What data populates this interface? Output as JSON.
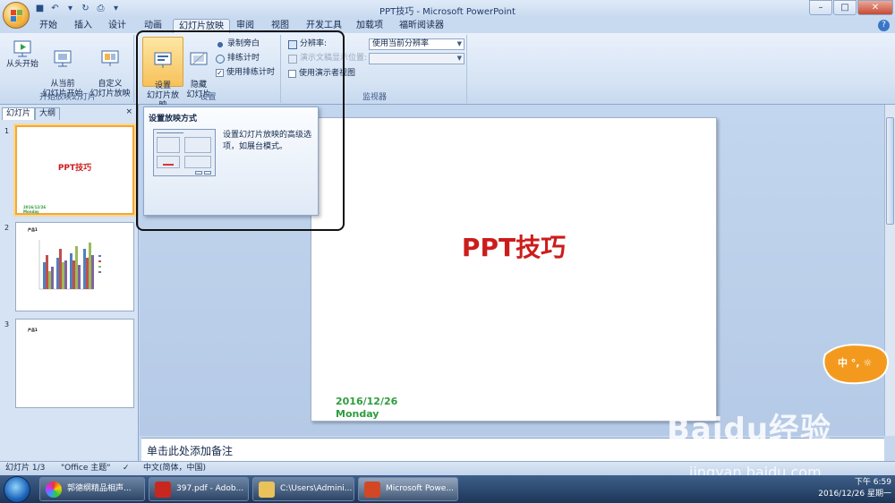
{
  "window": {
    "title": "PPT技巧 - Microsoft PowerPoint",
    "minimize": "–",
    "maximize": "□",
    "close": "✕"
  },
  "tabs": [
    {
      "label": "开始"
    },
    {
      "label": "插入"
    },
    {
      "label": "设计"
    },
    {
      "label": "动画"
    },
    {
      "label": "幻灯片放映"
    },
    {
      "label": "审阅"
    },
    {
      "label": "视图"
    },
    {
      "label": "开发工具"
    },
    {
      "label": "加载项"
    },
    {
      "label": "福昕阅读器"
    }
  ],
  "ribbon": {
    "start_group": {
      "label": "开始放映幻灯片",
      "from_beginning": "从头开始",
      "from_current": "从当前\n幻灯片开始",
      "custom": "自定义\n幻灯片放映"
    },
    "setup_group": {
      "label": "设置",
      "setup_show": "设置\n幻灯片放映",
      "hide_slide": "隐藏\n幻灯片",
      "record_narration": "录制旁白",
      "rehearse_timings": "排练计时",
      "use_rehearsed": "使用排练计时"
    },
    "monitors_group": {
      "label": "监视器",
      "resolution_label": "分辨率:",
      "resolution_value": "使用当前分辨率",
      "show_on_label": "演示文稿显示位置:",
      "presenter_view": "使用演示者视图"
    }
  },
  "tooltip": {
    "title": "设置放映方式",
    "text": "设置幻灯片放映的高级选项，如展台模式。"
  },
  "left_panel": {
    "tab_slides": "幻灯片",
    "tab_outline": "大纲",
    "close": "×",
    "slides": [
      {
        "num": "1",
        "title": "PPT技巧",
        "date": "2016/12/26",
        "day": "Monday"
      },
      {
        "num": "2",
        "title": "产品1"
      },
      {
        "num": "3",
        "title": "产品1"
      }
    ]
  },
  "slide": {
    "title": "PPT技巧",
    "date": "2016/12/26",
    "day": "Monday"
  },
  "notes": {
    "placeholder": "单击此处添加备注"
  },
  "status": {
    "slide_index": "幻灯片 1/3",
    "theme": "\"Office 主题\"",
    "language": "中文(简体，中国)"
  },
  "taskbar": {
    "items": [
      {
        "label": "郭德纲精品相声..."
      },
      {
        "label": "397.pdf - Adob..."
      },
      {
        "label": "C:\\Users\\Admini..."
      },
      {
        "label": "Microsoft Powe..."
      }
    ],
    "time": "下午 6:59",
    "date": "2016/12/26 星期一"
  },
  "ime": {
    "label": "中 °, ☼"
  },
  "watermark": {
    "text": "Baidu经验",
    "url": "jingyan.baidu.com"
  }
}
